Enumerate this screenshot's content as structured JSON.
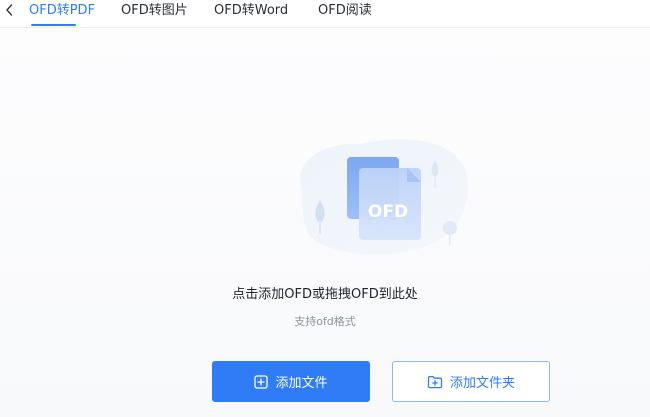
{
  "tabs": [
    {
      "label": "OFD转PDF",
      "active": true
    },
    {
      "label": "OFD转图片",
      "active": false
    },
    {
      "label": "OFD转Word",
      "active": false
    },
    {
      "label": "OFD阅读",
      "active": false
    }
  ],
  "illustration": {
    "file_badge": "OFD"
  },
  "dropzone": {
    "title": "点击添加OFD或拖拽OFD到此处",
    "subtitle": "支持ofd格式"
  },
  "buttons": {
    "add_file": "添加文件",
    "add_folder": "添加文件夹"
  },
  "colors": {
    "accent": "#2f7cf6",
    "background": "#ffffff",
    "border_light": "#8fb8f7"
  },
  "icons": {
    "back": "chevron-left-icon",
    "add_file": "plus-square-icon",
    "add_folder": "folder-plus-icon"
  }
}
